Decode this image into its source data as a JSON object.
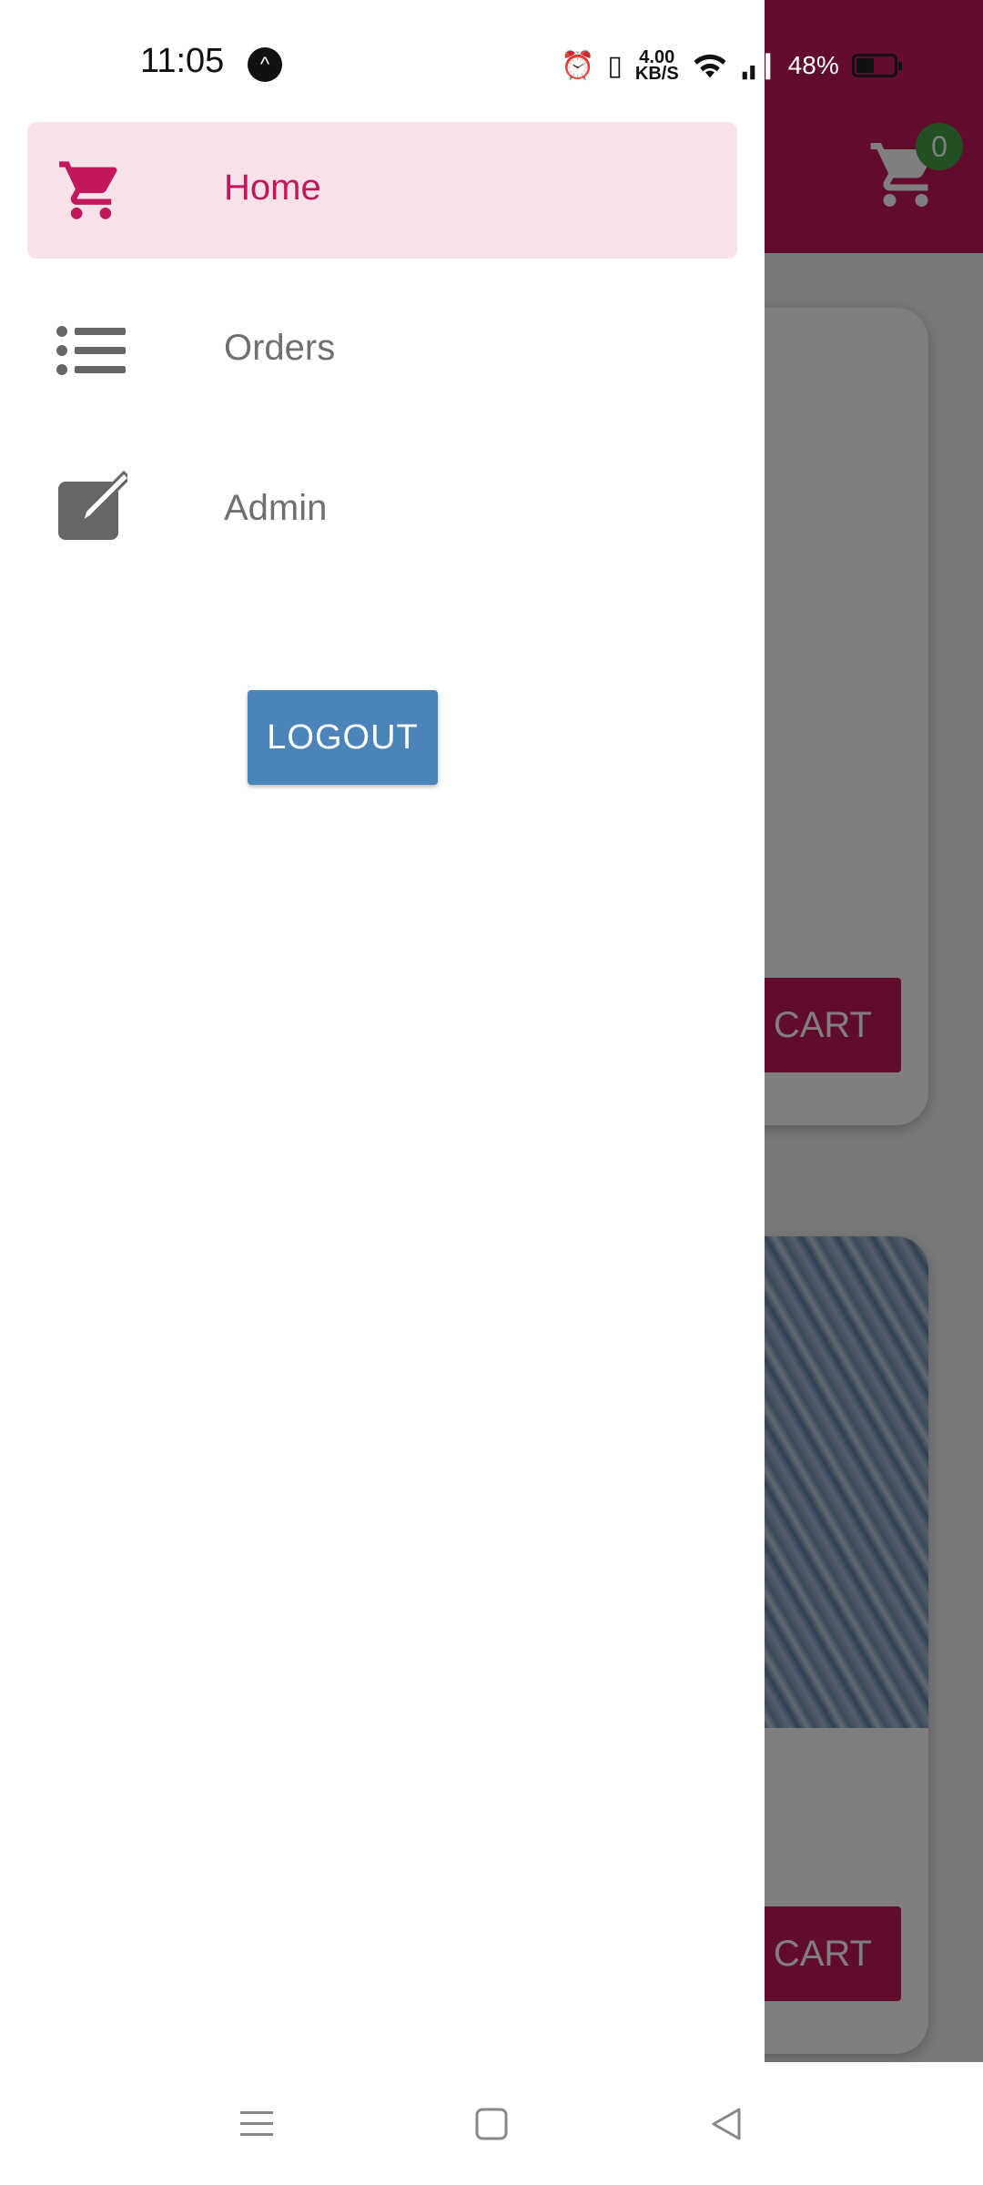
{
  "status_bar": {
    "time": "11:05",
    "notification_icon": "a-logo-icon",
    "net_speed_value": "4.00",
    "net_speed_unit": "KB/S",
    "battery_percent": "48%",
    "battery_level": 0.48
  },
  "drawer": {
    "items": [
      {
        "label": "Home",
        "icon": "cart-icon",
        "active": true
      },
      {
        "label": "Orders",
        "icon": "list-icon",
        "active": false
      },
      {
        "label": "Admin",
        "icon": "edit-icon",
        "active": false
      }
    ],
    "logout_label": "LOGOUT"
  },
  "background_app": {
    "cart_badge": "0",
    "add_to_cart_label_visible": "CART",
    "accent_color": "#c2185b"
  },
  "colors": {
    "accent": "#c2185b",
    "active_bg": "#f8e2ea",
    "logout": "#4a84b8",
    "badge": "#43a047"
  },
  "system_nav": {
    "buttons": [
      "menu-icon",
      "home-square-icon",
      "back-triangle-icon"
    ]
  }
}
